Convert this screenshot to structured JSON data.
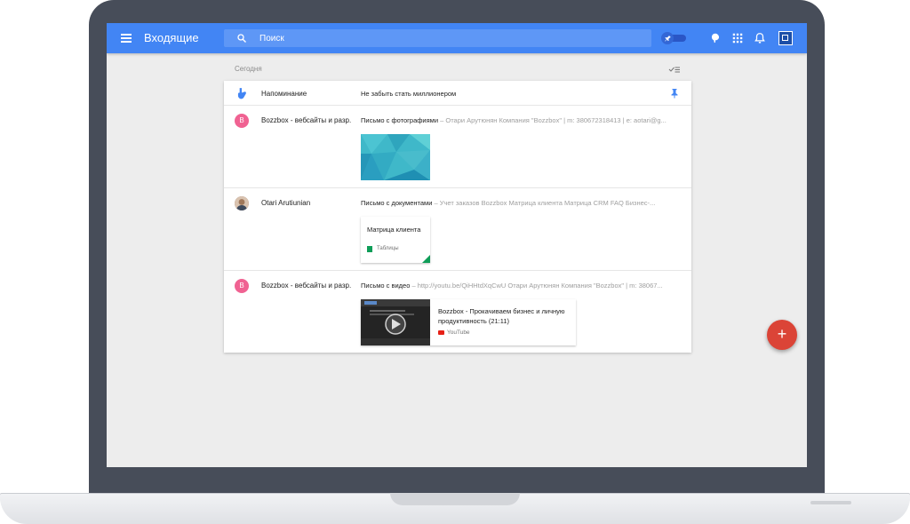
{
  "header": {
    "title": "Входящие",
    "search_placeholder": "Поиск"
  },
  "section": {
    "label": "Сегодня"
  },
  "reminder": {
    "label": "Напоминание",
    "text": "Не забыть стать миллионером"
  },
  "messages": [
    {
      "avatar_letter": "B",
      "avatar_color": "#f06292",
      "sender": "Bozzbox - вебсайты и разр.",
      "subject": "Письмо с фотографиями",
      "snippet": " – Отари Арутюнян Компания \"Bozzbox\" | m: 380672318413 | e: aotari@g..."
    },
    {
      "avatar_letter": "",
      "sender": "Otari Arutiunian",
      "subject": "Письмо с документами",
      "snippet": " –  Учет заказов Bozzbox  Матрица клиента  Матрица CRM  FAQ  Бизнес-...",
      "attachment_title": "Матрица клиента",
      "attachment_type": "Таблицы"
    },
    {
      "avatar_letter": "B",
      "avatar_color": "#f06292",
      "sender": "Bozzbox - вебсайты и разр.",
      "subject": "Письмо с видео",
      "snippet": " – http://youtu.be/QiHHtdXqCwU Отари Арутюнян Компания \"Bozzbox\" | m: 38067...",
      "video_title": "Bozzbox - Прокачиваем бизнес и личную продуктивность (21:11)",
      "video_source": "YouTube"
    }
  ],
  "fab": {
    "label": "+"
  },
  "colors": {
    "app_bar": "#4285f4",
    "reminder_icon": "#4285f4",
    "fab": "#db4437",
    "sheets": "#0f9d58"
  }
}
